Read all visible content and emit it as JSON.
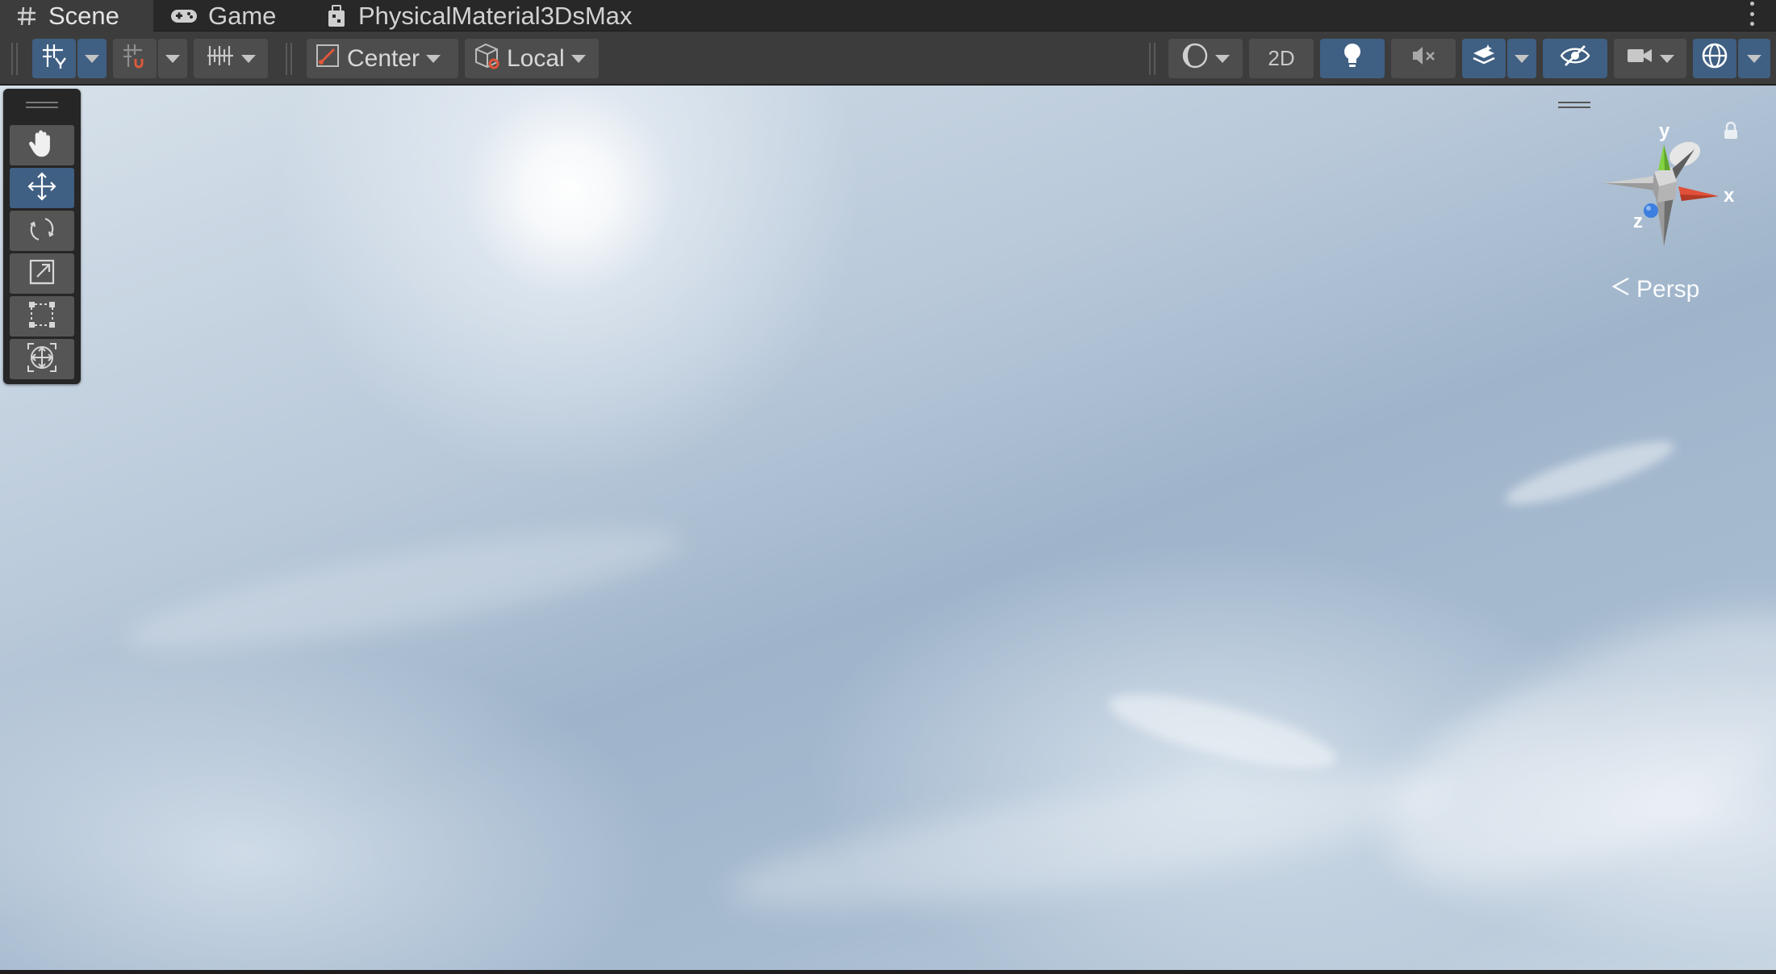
{
  "tabs": [
    {
      "label": "Scene",
      "icon": "hash-icon",
      "active": true
    },
    {
      "label": "Game",
      "icon": "gamepad-icon",
      "active": false
    },
    {
      "label": "PhysicalMaterial3DsMax",
      "icon": "prefab-icon",
      "active": false
    }
  ],
  "toolbar": {
    "pivot_position": "Center",
    "pivot_rotation": "Local",
    "mode_2d": "2D"
  },
  "gizmo": {
    "axis_x": "x",
    "axis_y": "y",
    "axis_z": "z",
    "projection": "Persp"
  },
  "colors": {
    "accent": "#3f5f83",
    "toolbar": "#3c3c3c",
    "tabbar": "#282828",
    "axis_x": "#e0503a",
    "axis_y": "#84d343",
    "axis_z": "#3d7fe0"
  },
  "tools": [
    "view-tool",
    "move-tool",
    "rotate-tool",
    "scale-tool",
    "rect-tool",
    "transform-tool"
  ]
}
